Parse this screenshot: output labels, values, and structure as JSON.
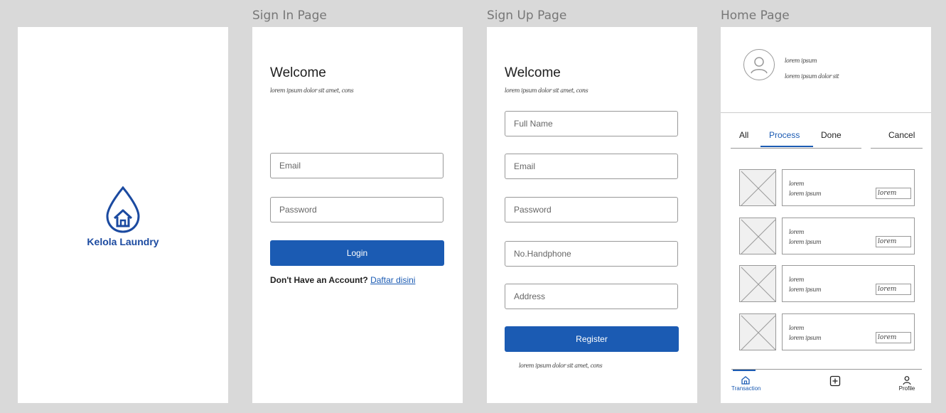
{
  "frames": {
    "splash": {
      "label": "",
      "brand": "Kelola Laundry"
    },
    "signin": {
      "label": "Sign In Page",
      "welcome": "Welcome",
      "subtitle": "lorem ipsum dolor sit amet, cons",
      "email_placeholder": "Email",
      "password_placeholder": "Password",
      "login_label": "Login",
      "no_account_text": "Don't Have an Account? ",
      "register_link": "Daftar disini"
    },
    "signup": {
      "label": "Sign Up Page",
      "welcome": "Welcome",
      "subtitle": "lorem ipsum dolor sit amet, cons",
      "full_name_placeholder": "Full Name",
      "email_placeholder": "Email",
      "password_placeholder": "Password",
      "phone_placeholder": "No.Handphone",
      "address_placeholder": "Address",
      "register_label": "Register",
      "footer": "lorem ipsum dolor sit amet, cons"
    },
    "home": {
      "label": "Home Page",
      "profile_line1": "lorem ipsum",
      "profile_line2": "lorem ipsum dolor sit",
      "tabs": [
        "All",
        "Process",
        "Done",
        "Cancel"
      ],
      "active_tab": "Process",
      "items": [
        {
          "line1": "lorem",
          "line2": "lorem ipsum",
          "badge": "lorem"
        },
        {
          "line1": "lorem",
          "line2": "lorem ipsum",
          "badge": "lorem"
        },
        {
          "line1": "lorem",
          "line2": "lorem ipsum",
          "badge": "lorem"
        },
        {
          "line1": "lorem",
          "line2": "lorem ipsum",
          "badge": "lorem"
        }
      ],
      "nav": [
        {
          "label": "Transaction",
          "icon": "home-icon",
          "active": true
        },
        {
          "label": "",
          "icon": "plus-square-icon",
          "active": false
        },
        {
          "label": "Profile",
          "icon": "user-icon",
          "active": false
        }
      ]
    }
  },
  "colors": {
    "primary": "#1b5bb3",
    "brand": "#1b4aa0",
    "canvas": "#d9d9d9"
  }
}
